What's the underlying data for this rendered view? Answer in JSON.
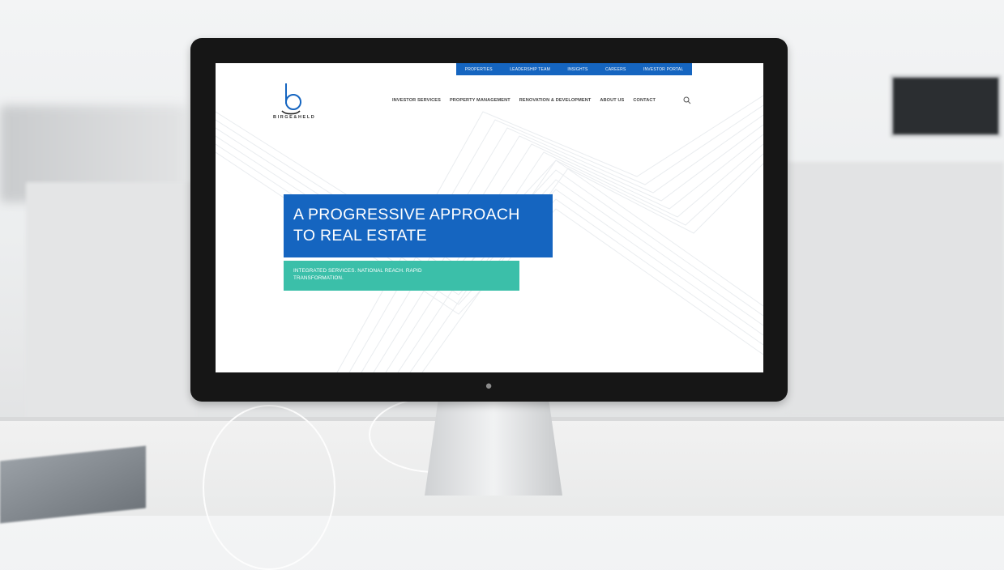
{
  "top_nav": {
    "items": [
      {
        "label": "PROPERTIES"
      },
      {
        "label": "LEADERSHIP TEAM"
      },
      {
        "label": "INSIGHTS"
      },
      {
        "label": "CAREERS"
      },
      {
        "label": "INVESTOR PORTAL"
      }
    ]
  },
  "brand": {
    "logo_letter": "b",
    "name": "BIRGE&HELD"
  },
  "main_nav": {
    "items": [
      {
        "label": "INVESTOR SERVICES"
      },
      {
        "label": "PROPERTY MANAGEMENT"
      },
      {
        "label": "RENOVATION & DEVELOPMENT"
      },
      {
        "label": "ABOUT US"
      },
      {
        "label": "CONTACT"
      }
    ],
    "search_icon": "search-icon"
  },
  "hero": {
    "title": "A PROGRESSIVE APPROACH TO REAL ESTATE",
    "subtitle": "INTEGRATED SERVICES. NATIONAL REACH. RAPID TRANSFORMATION."
  },
  "colors": {
    "primary_blue": "#1565c0",
    "teal": "#3bbfa9",
    "bezel": "#161616"
  }
}
